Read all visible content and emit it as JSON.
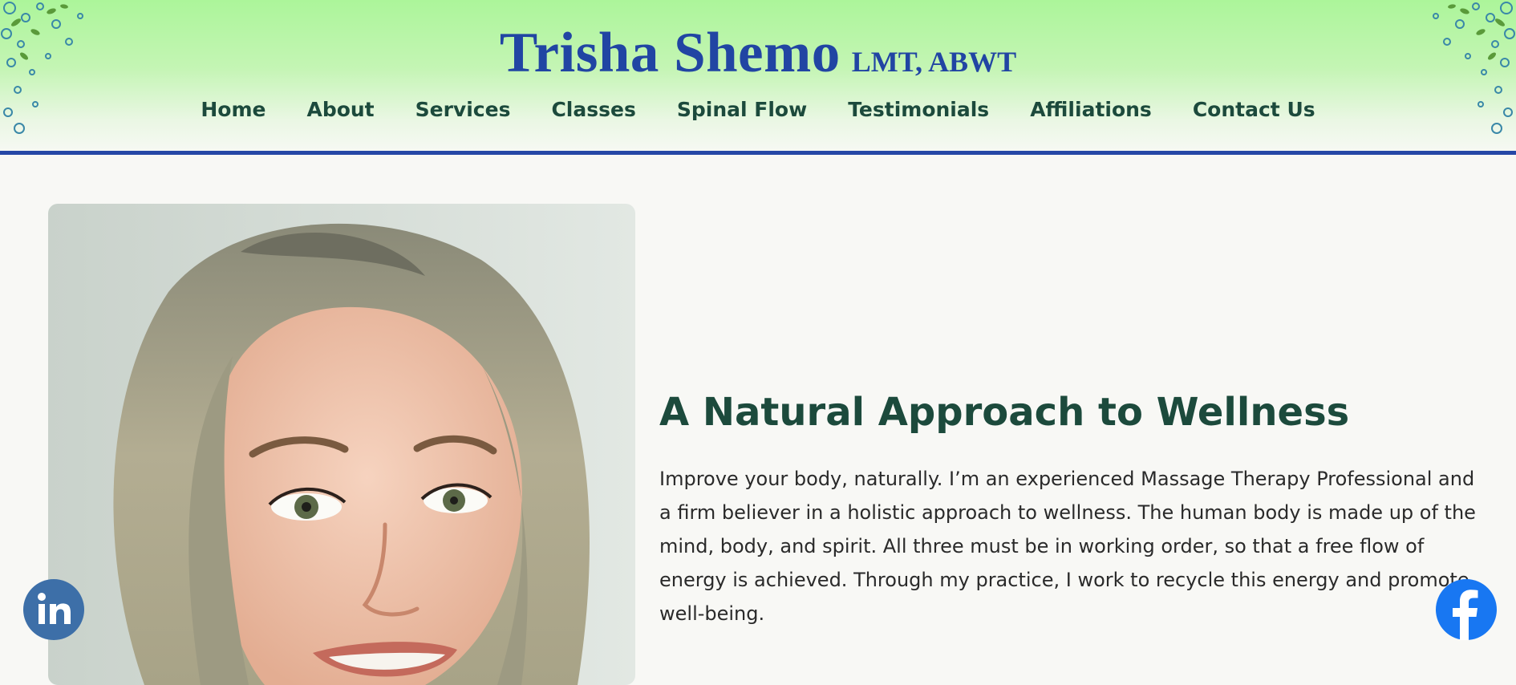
{
  "site": {
    "name": "Trisha Shemo",
    "credentials": "LMT, ABWT"
  },
  "nav": {
    "items": [
      {
        "label": "Home"
      },
      {
        "label": "About"
      },
      {
        "label": "Services"
      },
      {
        "label": "Classes"
      },
      {
        "label": "Spinal Flow"
      },
      {
        "label": "Testimonials"
      },
      {
        "label": "Affiliations"
      },
      {
        "label": "Contact Us"
      }
    ]
  },
  "hero": {
    "heading": "A Natural Approach to Wellness",
    "body": "Improve your body, naturally. I’m an experienced Massage Therapy Professional and a firm believer in a holistic approach to wellness. The human body is made up of the mind, body, and spirit. All three must be in working order, so that a free flow of energy is achieved. Through my practice, I work to recycle this energy and promote well-being."
  },
  "social": {
    "linkedin_icon": "linkedin-icon",
    "facebook_icon": "facebook-icon"
  },
  "colors": {
    "title_blue": "#2145a3",
    "nav_green": "#1c4a3c",
    "header_rule": "#2647a6",
    "linkedin": "#3d6fa8",
    "facebook": "#1877f2"
  }
}
